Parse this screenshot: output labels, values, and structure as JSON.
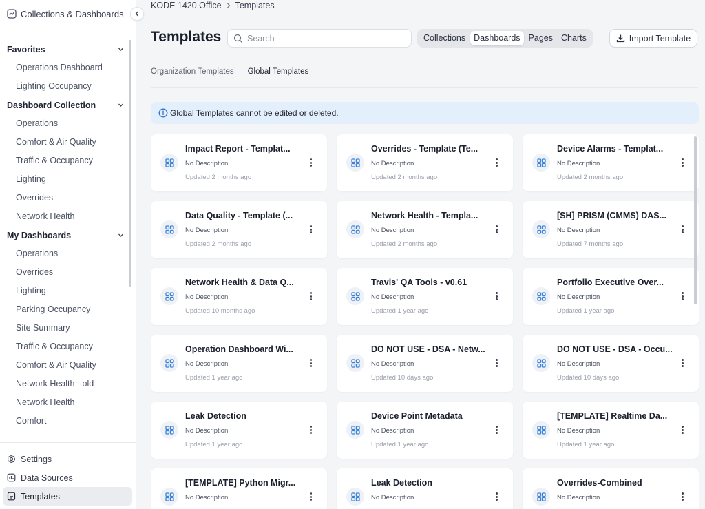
{
  "sidebar": {
    "top_label": "Collections & Dashboards",
    "sections": [
      {
        "title": "Favorites",
        "items": [
          "Operations Dashboard",
          "Lighting Occupancy"
        ]
      },
      {
        "title": "Dashboard Collection",
        "items": [
          "Operations",
          "Comfort & Air Quality",
          "Traffic & Occupancy",
          "Lighting",
          "Overrides",
          "Network Health"
        ]
      },
      {
        "title": "My Dashboards",
        "items": [
          "Operations",
          "Overrides",
          "Lighting",
          "Parking Occupancy",
          "Site Summary",
          "Traffic & Occupancy",
          "Comfort & Air Quality",
          "Network Health - old",
          "Network Health",
          "Comfort"
        ]
      }
    ],
    "bottom": [
      {
        "label": "Settings",
        "icon": "gear-icon"
      },
      {
        "label": "Data Sources",
        "icon": "database-icon"
      },
      {
        "label": "Templates",
        "icon": "template-icon",
        "active": true
      }
    ]
  },
  "breadcrumb": {
    "site": "KODE 1420 Office",
    "current": "Templates"
  },
  "header": {
    "title": "Templates",
    "search_placeholder": "Search",
    "segments": [
      "Collections",
      "Dashboards",
      "Pages",
      "Charts"
    ],
    "active_segment": "Dashboards",
    "import_label": "Import Template"
  },
  "tabs": [
    {
      "label": "Organization Templates",
      "active": false
    },
    {
      "label": "Global Templates",
      "active": true
    }
  ],
  "info_text": "Global Templates cannot be edited or deleted.",
  "colors": {
    "accent": "#2f6fd8",
    "info_bg": "#e3f0fc",
    "icon_blue": "#3b82d6"
  },
  "templates": [
    {
      "title": "Impact Report - Templat...",
      "description": "No Description",
      "updated": "Updated 2 months ago"
    },
    {
      "title": "Overrides - Template (Te...",
      "description": "No Description",
      "updated": "Updated 2 months ago"
    },
    {
      "title": "Device Alarms - Templat...",
      "description": "No Description",
      "updated": "Updated 2 months ago"
    },
    {
      "title": "Data Quality - Template (...",
      "description": "No Description",
      "updated": "Updated 2 months ago"
    },
    {
      "title": "Network Health - Templa...",
      "description": "No Description",
      "updated": "Updated 2 months ago"
    },
    {
      "title": "[SH] PRISM (CMMS) DAS...",
      "description": "No Description",
      "updated": "Updated 7 months ago"
    },
    {
      "title": "Network Health & Data Q...",
      "description": "No Description",
      "updated": "Updated 10 months ago"
    },
    {
      "title": "Travis' QA Tools - v0.61",
      "description": "No Description",
      "updated": "Updated 1 year ago"
    },
    {
      "title": "Portfolio Executive Over...",
      "description": "No Description",
      "updated": "Updated 1 year ago"
    },
    {
      "title": "Operation Dashboard Wi...",
      "description": "No Description",
      "updated": "Updated 1 year ago"
    },
    {
      "title": "DO NOT USE - DSA - Netw...",
      "description": "No Description",
      "updated": "Updated 10 days ago"
    },
    {
      "title": "DO NOT USE - DSA - Occu...",
      "description": "No Description",
      "updated": "Updated 10 days ago"
    },
    {
      "title": "Leak Detection",
      "description": "No Description",
      "updated": "Updated 1 year ago"
    },
    {
      "title": "Device Point Metadata",
      "description": "No Description",
      "updated": "Updated 1 year ago"
    },
    {
      "title": "[TEMPLATE] Realtime Da...",
      "description": "No Description",
      "updated": "Updated 1 year ago"
    },
    {
      "title": "[TEMPLATE] Python Migr...",
      "description": "No Description",
      "updated": ""
    },
    {
      "title": "Leak Detection",
      "description": "No Description",
      "updated": ""
    },
    {
      "title": "Overrides-Combined",
      "description": "No Description",
      "updated": ""
    }
  ]
}
